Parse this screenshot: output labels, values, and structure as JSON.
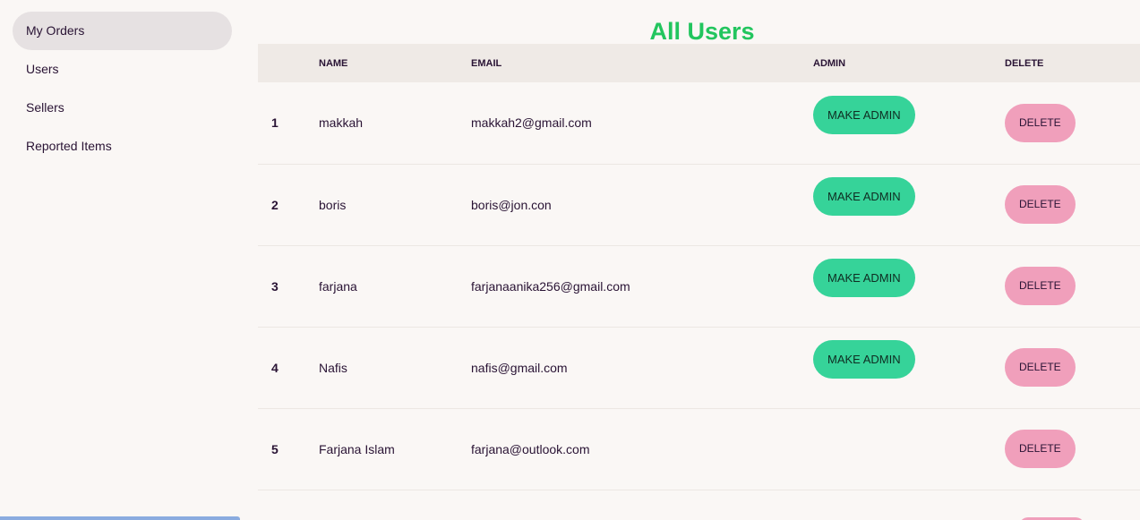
{
  "sidebar": {
    "items": [
      {
        "label": "My Orders",
        "active": true
      },
      {
        "label": "Users",
        "active": false
      },
      {
        "label": "Sellers",
        "active": false
      },
      {
        "label": "Reported Items",
        "active": false
      }
    ]
  },
  "main": {
    "title": "All Users",
    "table": {
      "headers": {
        "index": "",
        "name": "NAME",
        "email": "EMAIL",
        "admin": "ADMIN",
        "delete": "DELETE"
      },
      "rows": [
        {
          "index": "1",
          "name": "makkah",
          "email": "makkah2@gmail.com",
          "admin_label": "MAKE ADMIN",
          "delete_label": "DELETE"
        },
        {
          "index": "2",
          "name": "boris",
          "email": "boris@jon.con",
          "admin_label": "MAKE ADMIN",
          "delete_label": "DELETE"
        },
        {
          "index": "3",
          "name": "farjana",
          "email": "farjanaanika256@gmail.com",
          "admin_label": "MAKE ADMIN",
          "delete_label": "DELETE"
        },
        {
          "index": "4",
          "name": "Nafis",
          "email": "nafis@gmail.com",
          "admin_label": "MAKE ADMIN",
          "delete_label": "DELETE"
        },
        {
          "index": "5",
          "name": "Farjana Islam",
          "email": "farjana@outlook.com",
          "admin_label": "",
          "delete_label": "DELETE"
        }
      ]
    }
  },
  "colors": {
    "title": "#22c55e",
    "admin_button": "#36d399",
    "delete_button": "#f09fbb",
    "active_menu": "#e6e1e2",
    "background": "#faf7f5"
  }
}
